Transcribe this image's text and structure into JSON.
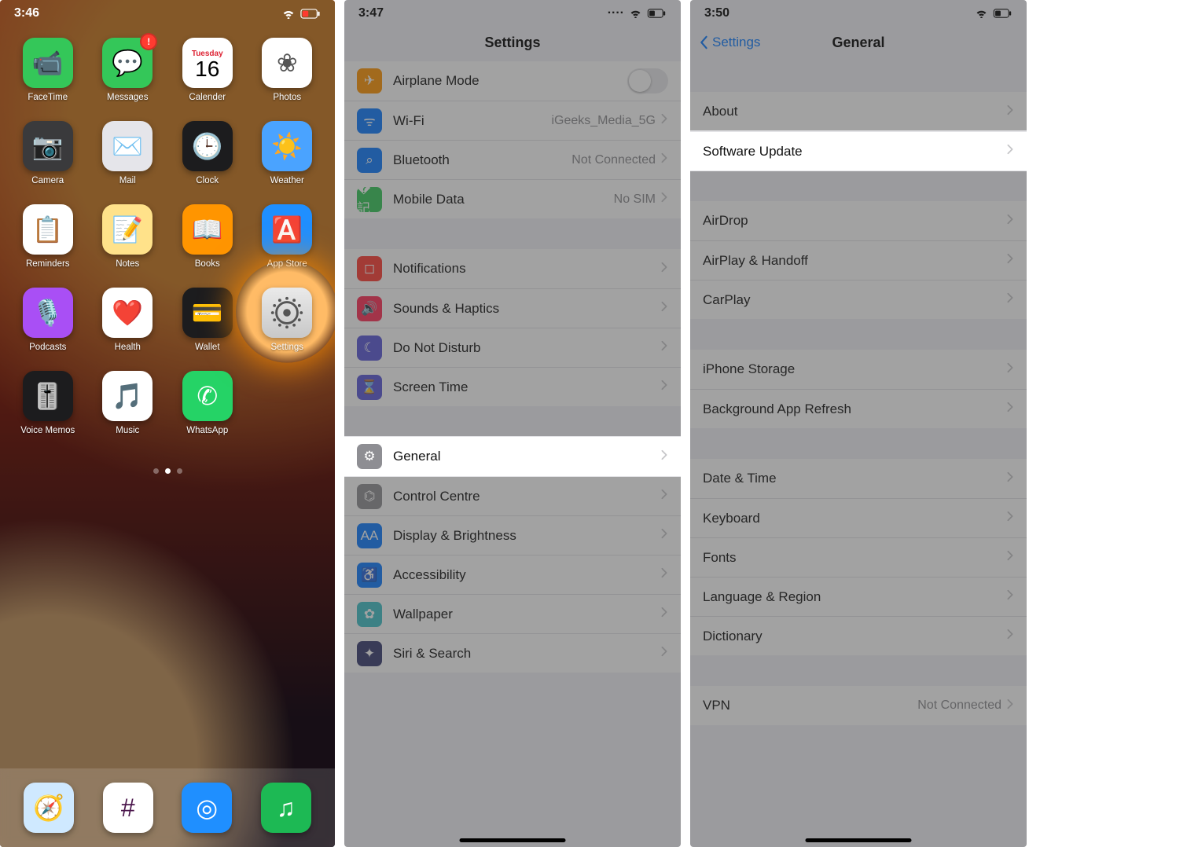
{
  "panel1": {
    "time": "3:46",
    "apps": [
      {
        "label": "FaceTime",
        "bg": "#34c759",
        "glyph": "📹"
      },
      {
        "label": "Messages",
        "bg": "#34c759",
        "glyph": "💬",
        "badge": "!"
      },
      {
        "label": "Calender",
        "bg": "#ffffff",
        "cal_dow": "Tuesday",
        "cal_date": "16"
      },
      {
        "label": "Photos",
        "bg": "#ffffff",
        "glyph": "❀"
      },
      {
        "label": "Camera",
        "bg": "#3a3a3c",
        "glyph": "📷"
      },
      {
        "label": "Mail",
        "bg": "#e5e5ea",
        "glyph": "✉️"
      },
      {
        "label": "Clock",
        "bg": "#1c1c1e",
        "glyph": "🕒"
      },
      {
        "label": "Weather",
        "bg": "#4aa3ff",
        "glyph": "☀️"
      },
      {
        "label": "Reminders",
        "bg": "#ffffff",
        "glyph": "📋"
      },
      {
        "label": "Notes",
        "bg": "#ffe28a",
        "glyph": "📝"
      },
      {
        "label": "Books",
        "bg": "#ff9500",
        "glyph": "📖"
      },
      {
        "label": "App Store",
        "bg": "#1f8fff",
        "glyph": "🅰️"
      },
      {
        "label": "Podcasts",
        "bg": "#a94ff5",
        "glyph": "🎙️"
      },
      {
        "label": "Health",
        "bg": "#ffffff",
        "glyph": "❤️"
      },
      {
        "label": "Wallet",
        "bg": "#1c1c1e",
        "glyph": "💳"
      },
      {
        "label": "Settings",
        "bg": "gear",
        "highlight": true
      },
      {
        "label": "Voice Memos",
        "bg": "#1c1c1e",
        "glyph": "🎚️"
      },
      {
        "label": "Music",
        "bg": "#ffffff",
        "glyph": "🎵"
      },
      {
        "label": "WhatsApp",
        "bg": "#25d366",
        "glyph": "✆"
      }
    ],
    "dock": [
      {
        "label": "Safari",
        "bg": "#cfe9ff",
        "glyph": "🧭"
      },
      {
        "label": "Slack",
        "bg": "#ffffff",
        "glyph": "#"
      },
      {
        "label": "Shazam",
        "bg": "#1f8fff",
        "glyph": "◎"
      },
      {
        "label": "Spotify",
        "bg": "#1db954",
        "glyph": "♫"
      }
    ]
  },
  "panel2": {
    "time": "3:47",
    "title": "Settings",
    "rows": [
      {
        "icon": "#ff9500",
        "glyph": "✈",
        "label": "Airplane Mode",
        "toggle": true
      },
      {
        "icon": "#0a7aff",
        "glyph": "ᯤ",
        "label": "Wi-Fi",
        "value": "iGeeks_Media_5G"
      },
      {
        "icon": "#0a7aff",
        "glyph": "⌕",
        "label": "Bluetooth",
        "value": "Not Connected"
      },
      {
        "icon": "#34c759",
        "glyph": "�記",
        "label": "Mobile Data",
        "value": "No SIM"
      },
      {
        "gap": true
      },
      {
        "icon": "#ff3b30",
        "glyph": "◻",
        "label": "Notifications"
      },
      {
        "icon": "#ff2d55",
        "glyph": "🔊",
        "label": "Sounds & Haptics"
      },
      {
        "icon": "#5856d6",
        "glyph": "☾",
        "label": "Do Not Disturb"
      },
      {
        "icon": "#5856d6",
        "glyph": "⌛",
        "label": "Screen Time"
      },
      {
        "gap": true
      },
      {
        "icon": "#8e8e93",
        "glyph": "⚙",
        "label": "General",
        "highlight": true
      },
      {
        "icon": "#8e8e93",
        "glyph": "⌬",
        "label": "Control Centre"
      },
      {
        "icon": "#0a7aff",
        "glyph": "AA",
        "label": "Display & Brightness"
      },
      {
        "icon": "#0a7aff",
        "glyph": "♿",
        "label": "Accessibility"
      },
      {
        "icon": "#3fc0c7",
        "glyph": "✿",
        "label": "Wallpaper"
      },
      {
        "icon": "#363b6f",
        "glyph": "✦",
        "label": "Siri & Search"
      }
    ]
  },
  "panel3": {
    "time": "3:50",
    "back": "Settings",
    "title": "General",
    "rows": [
      {
        "gap": true
      },
      {
        "label": "About"
      },
      {
        "label": "Software Update",
        "highlight": true
      },
      {
        "gap": true
      },
      {
        "label": "AirDrop"
      },
      {
        "label": "AirPlay & Handoff"
      },
      {
        "label": "CarPlay"
      },
      {
        "gap": true
      },
      {
        "label": "iPhone Storage"
      },
      {
        "label": "Background App Refresh"
      },
      {
        "gap": true
      },
      {
        "label": "Date & Time"
      },
      {
        "label": "Keyboard"
      },
      {
        "label": "Fonts"
      },
      {
        "label": "Language & Region"
      },
      {
        "label": "Dictionary"
      },
      {
        "gap": true
      },
      {
        "label": "VPN",
        "value": "Not Connected"
      }
    ]
  }
}
